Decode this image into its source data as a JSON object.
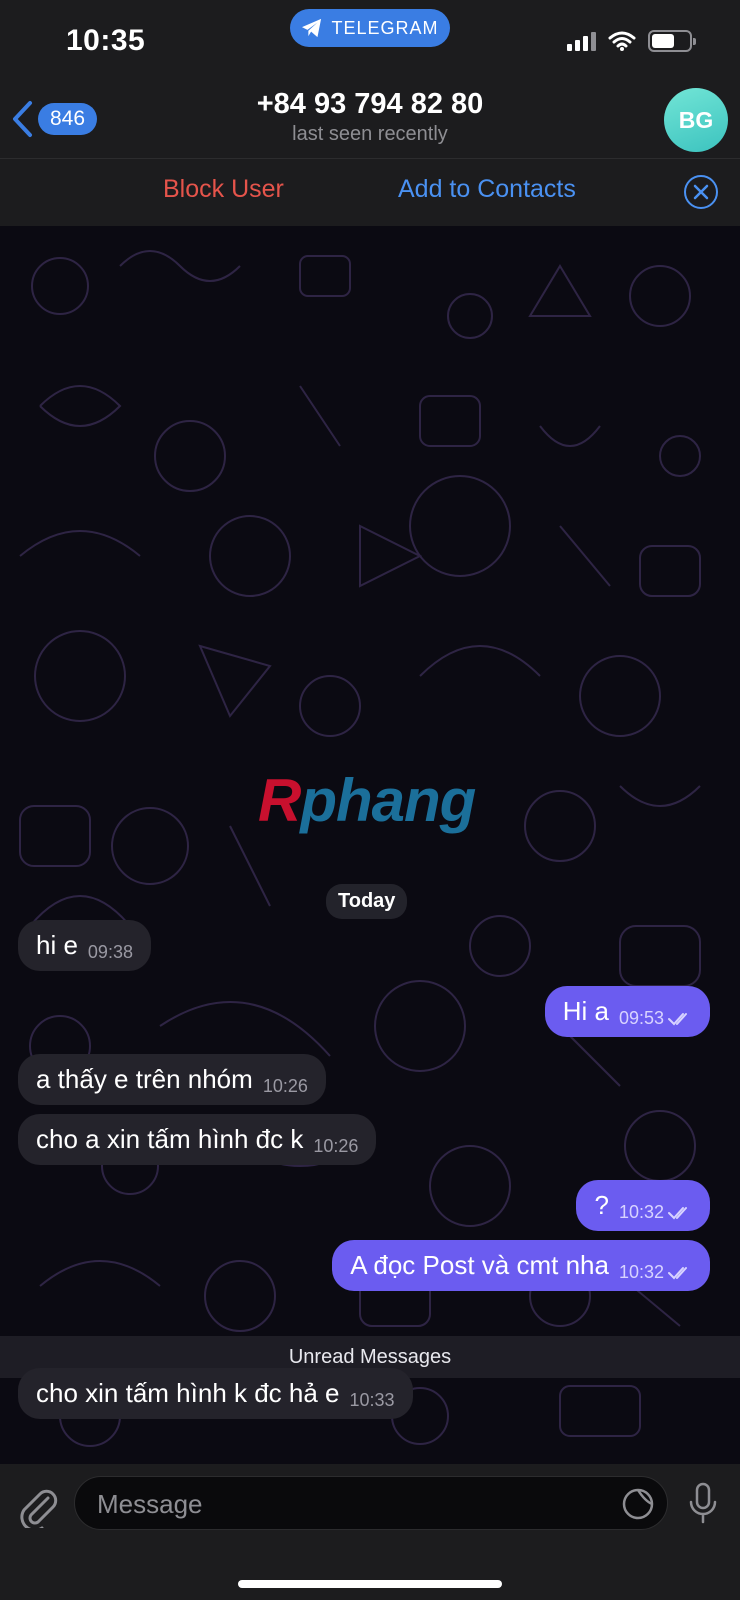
{
  "status_bar": {
    "time": "10:35",
    "app_pill": "TELEGRAM"
  },
  "header": {
    "back_count": "846",
    "title": "+84 93 794 82 80",
    "subtitle": "last seen recently",
    "avatar_initials": "BG"
  },
  "actions": {
    "block_label": "Block User",
    "add_label": "Add to Contacts"
  },
  "chat": {
    "watermark_a": "R",
    "watermark_b": "phang",
    "date_label": "Today",
    "unread_label": "Unread Messages",
    "messages": [
      {
        "direction": "in",
        "text": "hi e",
        "time": "09:38"
      },
      {
        "direction": "out",
        "text": "Hi a",
        "time": "09:53",
        "read": true
      },
      {
        "direction": "in",
        "text": "a thấy e trên nhóm",
        "time": "10:26"
      },
      {
        "direction": "in",
        "text": "cho a xin tấm hình đc k",
        "time": "10:26"
      },
      {
        "direction": "out",
        "text": "?",
        "time": "10:32",
        "read": true
      },
      {
        "direction": "out",
        "text": "A đọc Post và cmt nha",
        "time": "10:32",
        "read": true
      },
      {
        "direction": "in",
        "text": "cho xin tấm hình k đc hả e",
        "time": "10:33"
      }
    ]
  },
  "composer": {
    "placeholder": "Message"
  },
  "colors": {
    "accent": "#3a7de3",
    "outgoing_bubble": "#6b5cf0",
    "incoming_bubble": "#24232b",
    "block_red": "#e5544b"
  }
}
